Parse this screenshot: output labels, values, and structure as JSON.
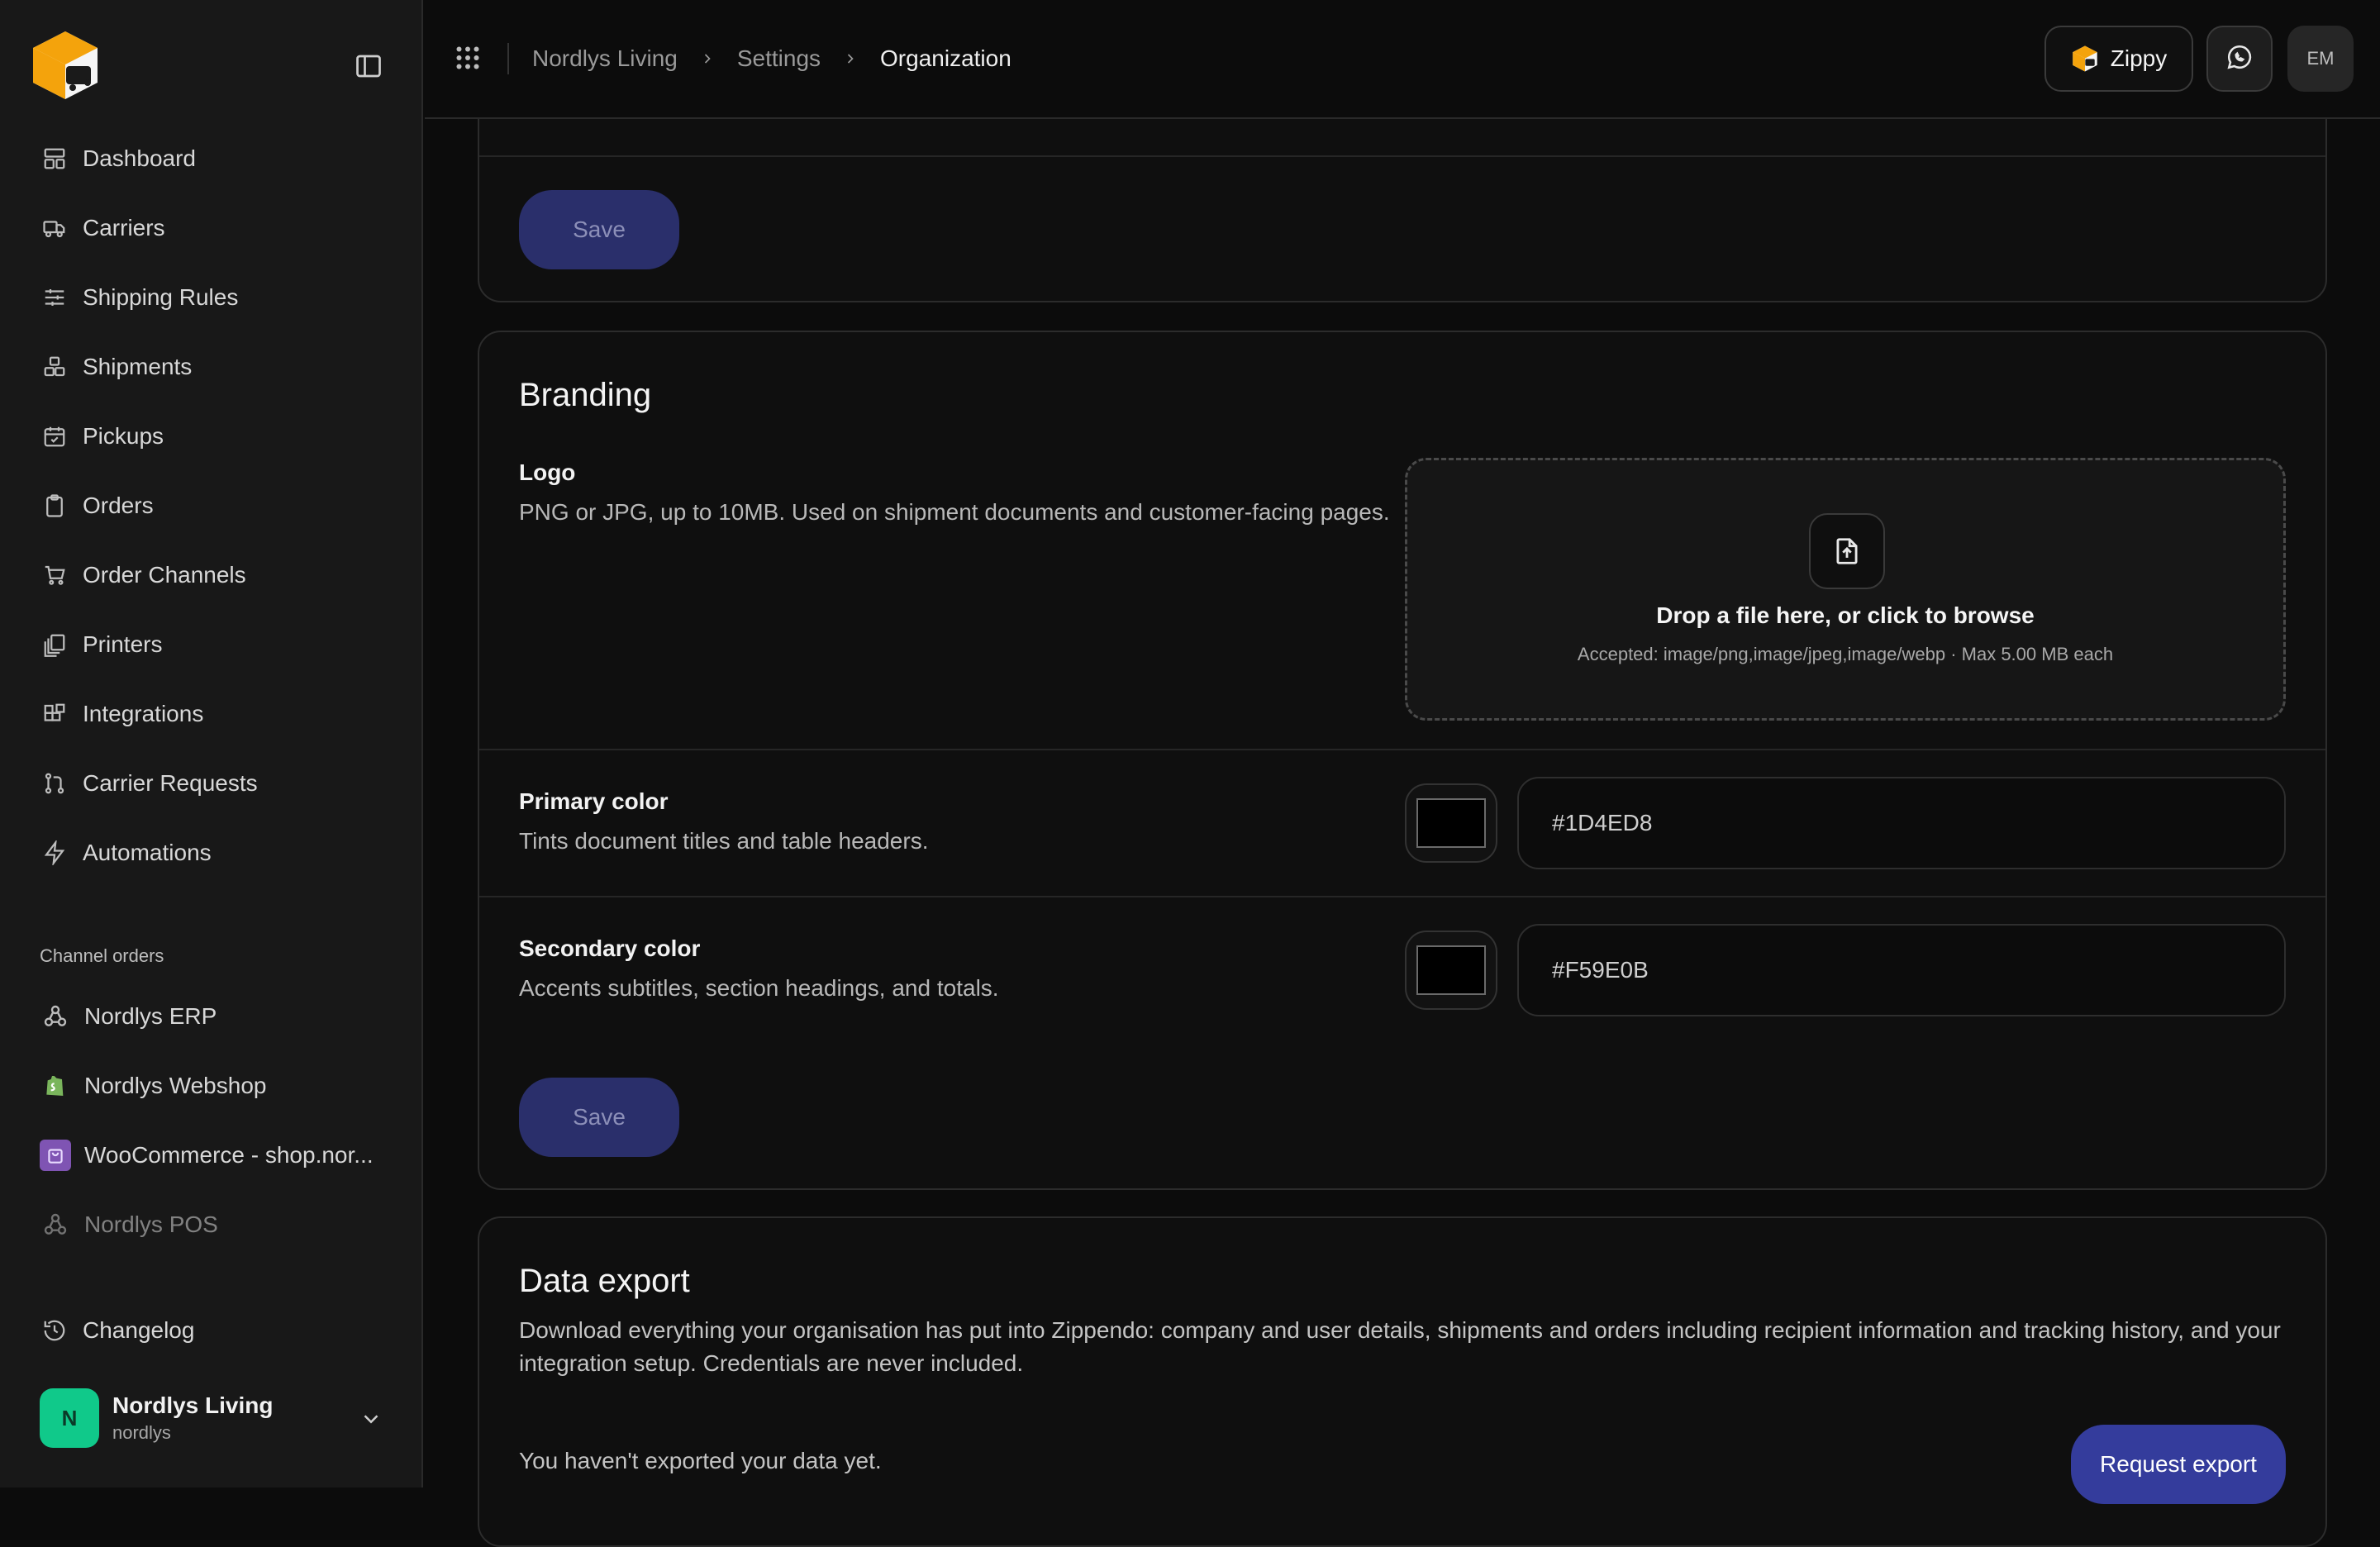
{
  "sidebar": {
    "nav": [
      {
        "label": "Dashboard",
        "icon": "dashboard-icon"
      },
      {
        "label": "Carriers",
        "icon": "truck-icon"
      },
      {
        "label": "Shipping Rules",
        "icon": "sliders-icon"
      },
      {
        "label": "Shipments",
        "icon": "boxes-icon"
      },
      {
        "label": "Pickups",
        "icon": "calendar-check-icon"
      },
      {
        "label": "Orders",
        "icon": "clipboard-icon"
      },
      {
        "label": "Order Channels",
        "icon": "cart-icon"
      },
      {
        "label": "Printers",
        "icon": "printer-icon"
      },
      {
        "label": "Integrations",
        "icon": "blocks-icon"
      },
      {
        "label": "Carrier Requests",
        "icon": "git-pull-request-icon"
      },
      {
        "label": "Automations",
        "icon": "bolt-icon"
      }
    ],
    "channel_section_label": "Channel orders",
    "channels": [
      {
        "label": "Nordlys ERP",
        "icon": "webhook-icon"
      },
      {
        "label": "Nordlys Webshop",
        "icon": "shopify-icon"
      },
      {
        "label": "WooCommerce - shop.nor...",
        "icon": "woocommerce-icon"
      },
      {
        "label": "Nordlys POS",
        "icon": "webhook-icon"
      }
    ],
    "changelog": "Changelog",
    "org": {
      "initial": "N",
      "name": "Nordlys Living",
      "handle": "nordlys"
    }
  },
  "topbar": {
    "breadcrumbs": [
      "Nordlys Living",
      "Settings",
      "Organization"
    ],
    "zippy_label": "Zippy",
    "avatar_initials": "EM"
  },
  "general_card": {
    "save_label": "Save"
  },
  "branding": {
    "title": "Branding",
    "logo_label": "Logo",
    "logo_desc": "PNG or JPG, up to 10MB. Used on shipment documents and customer-facing pages.",
    "dropzone_title": "Drop a file here, or click to browse",
    "dropzone_sub": "Accepted: image/png,image/jpeg,image/webp · Max 5.00 MB each",
    "primary_label": "Primary color",
    "primary_desc": "Tints document titles and table headers.",
    "primary_value": "#1D4ED8",
    "secondary_label": "Secondary color",
    "secondary_desc": "Accents subtitles, section headings, and totals.",
    "secondary_value": "#F59E0B",
    "save_label": "Save"
  },
  "export": {
    "title": "Data export",
    "desc": "Download everything your organisation has put into Zippendo: company and user details, shipments and orders including recipient information and tracking history, and your integration setup. Credentials are never included.",
    "status": "You haven't exported your data yet.",
    "button_label": "Request export"
  }
}
